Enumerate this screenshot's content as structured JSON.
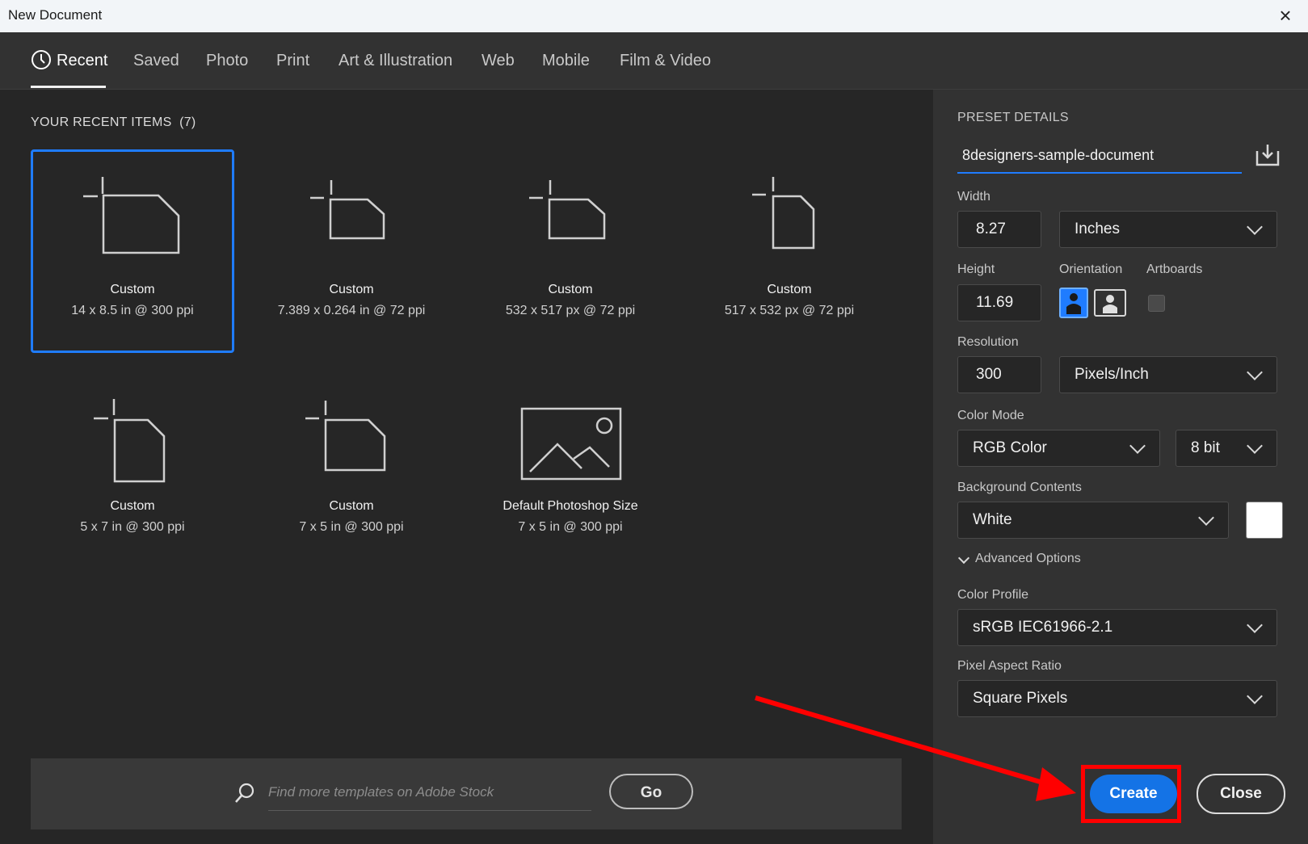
{
  "window": {
    "title": "New Document",
    "close_glyph": "×"
  },
  "tabs": [
    {
      "label": "Recent"
    },
    {
      "label": "Saved"
    },
    {
      "label": "Photo"
    },
    {
      "label": "Print"
    },
    {
      "label": "Art & Illustration"
    },
    {
      "label": "Web"
    },
    {
      "label": "Mobile"
    },
    {
      "label": "Film & Video"
    }
  ],
  "recent": {
    "heading": "YOUR RECENT ITEMS",
    "count": "(7)",
    "items": [
      {
        "name": "Custom",
        "dims": "14 x 8.5 in @ 300 ppi",
        "icon": "landscape-document-icon"
      },
      {
        "name": "Custom",
        "dims": "7.389 x 0.264 in @ 72 ppi",
        "icon": "landscape-document-icon"
      },
      {
        "name": "Custom",
        "dims": "532 x 517 px @ 72 ppi",
        "icon": "landscape-document-icon"
      },
      {
        "name": "Custom",
        "dims": "517 x 532 px @ 72 ppi",
        "icon": "portrait-document-icon"
      },
      {
        "name": "Custom",
        "dims": "5 x 7 in @ 300 ppi",
        "icon": "portrait-document-icon"
      },
      {
        "name": "Custom",
        "dims": "7 x 5 in @ 300 ppi",
        "icon": "landscape-document-icon"
      },
      {
        "name": "Default Photoshop Size",
        "dims": "7 x 5 in @ 300 ppi",
        "icon": "image-placeholder-icon"
      }
    ]
  },
  "search": {
    "placeholder": "Find more templates on Adobe Stock",
    "go_label": "Go"
  },
  "preset": {
    "heading": "PRESET DETAILS",
    "name": "8designers-sample-document",
    "width_label": "Width",
    "width_value": "8.27",
    "width_unit": "Inches",
    "height_label": "Height",
    "height_value": "11.69",
    "orientation_label": "Orientation",
    "artboards_label": "Artboards",
    "resolution_label": "Resolution",
    "resolution_value": "300",
    "resolution_unit": "Pixels/Inch",
    "color_mode_label": "Color Mode",
    "color_mode_value": "RGB Color",
    "bit_depth_value": "8 bit",
    "background_label": "Background Contents",
    "background_value": "White",
    "background_swatch": "#ffffff",
    "advanced_label": "Advanced Options",
    "color_profile_label": "Color Profile",
    "color_profile_value": "sRGB IEC61966-2.1",
    "pixel_aspect_label": "Pixel Aspect Ratio",
    "pixel_aspect_value": "Square Pixels"
  },
  "actions": {
    "create_label": "Create",
    "close_label": "Close"
  },
  "colors": {
    "accent": "#1473e6",
    "selection": "#1f7cff",
    "highlight": "#ff0000"
  }
}
